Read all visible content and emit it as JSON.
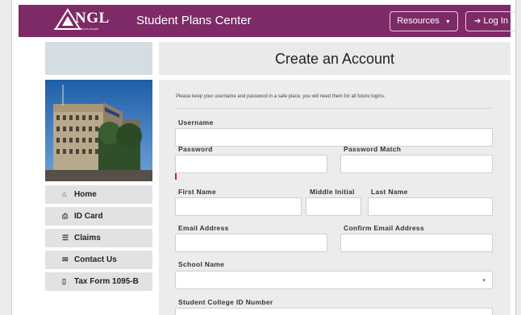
{
  "header": {
    "logo": "NGL",
    "logo_tagline": "It's about people.",
    "brand": "Student Plans Center",
    "resources_label": "Resources",
    "login_label": "Log In"
  },
  "sidebar": {
    "items": [
      {
        "icon": "home-icon",
        "label": "Home"
      },
      {
        "icon": "print-icon",
        "label": "ID Card"
      },
      {
        "icon": "list-icon",
        "label": "Claims"
      },
      {
        "icon": "envelope-icon",
        "label": "Contact Us"
      },
      {
        "icon": "document-icon",
        "label": "Tax Form 1095-B"
      }
    ]
  },
  "main": {
    "heading": "Create an Account",
    "notice": "Please keep your username and password in a safe place, you will need them for all future logins."
  },
  "form": {
    "username_label": "Username",
    "password_label": "Password",
    "password_match_label": "Password Match",
    "first_name_label": "First Name",
    "middle_initial_label": "Middle Initial",
    "last_name_label": "Last Name",
    "email_label": "Email Address",
    "confirm_email_label": "Confirm Email Address",
    "school_label": "School Name",
    "school_value": "",
    "student_id_label": "Student College ID Number"
  },
  "colors": {
    "brand": "#7d2a67",
    "panel": "#ececec",
    "sidebar_accent": "#d4dde2",
    "error": "#cc2222"
  }
}
